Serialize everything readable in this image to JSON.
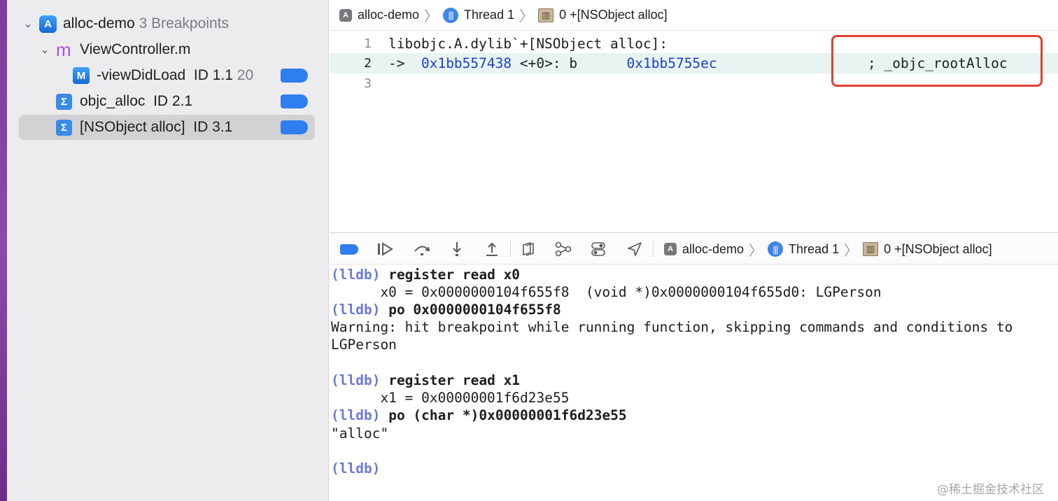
{
  "sidebar": {
    "items": [
      {
        "label": "alloc-demo",
        "sub": "3 Breakpoints",
        "icon": "app-icon",
        "icon_glyph": "A"
      },
      {
        "label": "ViewController.m",
        "icon": "objc-file-icon",
        "icon_glyph": "m"
      },
      {
        "label": "-viewDidLoad",
        "sub_id": "ID 1.1",
        "sub_line": "20",
        "icon": "method-icon",
        "icon_glyph": "M"
      },
      {
        "label": "objc_alloc",
        "sub_id": "ID 2.1",
        "icon": "symbolic-breakpoint-icon",
        "icon_glyph": "Σ"
      },
      {
        "label": "[NSObject alloc]",
        "sub_id": "ID 3.1",
        "icon": "symbolic-breakpoint-icon",
        "icon_glyph": "Σ"
      }
    ]
  },
  "jumpbar": {
    "project": "alloc-demo",
    "thread": "Thread 1",
    "frame": "0 +[NSObject alloc]"
  },
  "editor": {
    "lines": [
      {
        "num": "1",
        "text": "libobjc.A.dylib`+[NSObject alloc]:"
      },
      {
        "num": "2",
        "arrow": "->",
        "addr": "0x1bb557438",
        "offset": "<+0>:",
        "op": "b",
        "target": "0x1bb5755ec",
        "comment": "; _objc_rootAlloc"
      },
      {
        "num": "3",
        "text": ""
      }
    ]
  },
  "debugbar": {
    "project": "alloc-demo",
    "thread": "Thread 1",
    "frame": "0 +[NSObject alloc]"
  },
  "console": {
    "prompt": "(lldb)",
    "lines": [
      {
        "type": "cmd",
        "text": "register read x0"
      },
      {
        "type": "out",
        "text": "      x0 = 0x0000000104f655f8  (void *)0x0000000104f655d0: LGPerson"
      },
      {
        "type": "cmd",
        "text": "po 0x0000000104f655f8"
      },
      {
        "type": "out",
        "text": "Warning: hit breakpoint while running function, skipping commands and conditions to"
      },
      {
        "type": "out",
        "text": "LGPerson"
      },
      {
        "type": "out",
        "text": ""
      },
      {
        "type": "cmd",
        "text": "register read x1"
      },
      {
        "type": "out",
        "text": "      x1 = 0x00000001f6d23e55"
      },
      {
        "type": "cmd",
        "text": "po (char *)0x00000001f6d23e55"
      },
      {
        "type": "out",
        "text": "\"alloc\""
      },
      {
        "type": "out",
        "text": ""
      },
      {
        "type": "prompt",
        "text": ""
      }
    ]
  },
  "watermark": "@稀土掘金技术社区",
  "colors": {
    "breakpoint_flag": "#2f7ef0",
    "annotation_box": "#e0402f",
    "lldb_prompt": "#6c79d6",
    "address": "#1e3fc8",
    "current_line": "#e7f4f1"
  }
}
